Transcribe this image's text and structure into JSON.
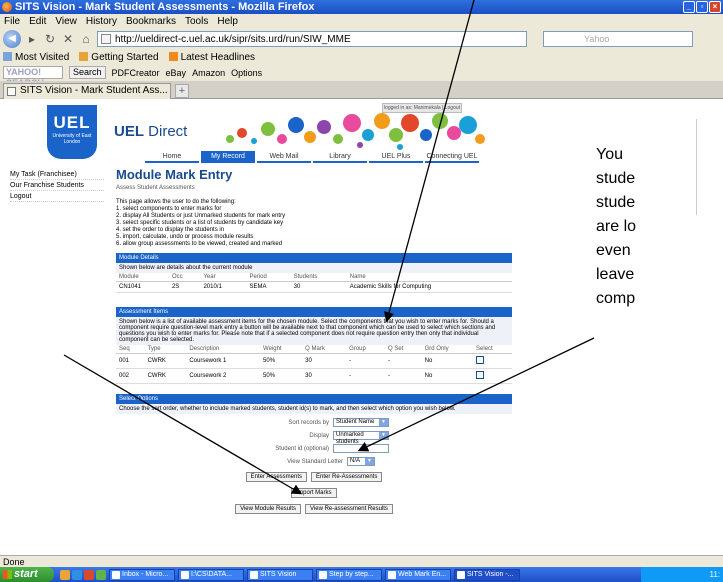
{
  "window": {
    "title": "SITS Vision - Mark Student Assessments - Mozilla Firefox"
  },
  "menu": [
    "File",
    "Edit",
    "View",
    "History",
    "Bookmarks",
    "Tools",
    "Help"
  ],
  "nav": {
    "url": "http://ueldirect-c.uel.ac.uk/sipr/sits.urd/run/SIW_MME",
    "search_placeholder": "Yahoo"
  },
  "bookmarks": [
    "Most Visited",
    "Getting Started",
    "Latest Headlines"
  ],
  "yahoo_toolbar": {
    "brand": "YAHOO! SEARCH",
    "search_label": "Search",
    "items": [
      "PDFCreator",
      "eBay",
      "Amazon",
      "Options"
    ]
  },
  "tabs": [
    {
      "label": "SITS Vision - Mark Student Ass..."
    }
  ],
  "portal": {
    "logo_big": "UEL",
    "logo_small": "University of East London",
    "brand": "UEL",
    "brand_rest": "Direct",
    "login_strip": "logged in as: Manimekala | Logout",
    "nav": [
      "Home",
      "My Record",
      "Web Mail",
      "Library",
      "UEL Plus",
      "Connecting UEL"
    ],
    "active_nav": "My Record"
  },
  "leftnav": [
    "My Task (Franchisee)",
    "Our Franchise Students",
    "Logout"
  ],
  "main": {
    "title": "Module Mark Entry",
    "subtitle": "Assess Student Assessments",
    "intro": [
      "This page allows the user to do the following:",
      "1. select components to enter marks for",
      "2. display All Students or just Unmarked students for mark entry",
      "3. select specific students or a list of students by candidate key",
      "4. set the order to display the students in",
      "5. import, calculate, undo or process module results",
      "6. allow group assessments to be viewed, created and marked"
    ],
    "module_details": {
      "header": "Module Details",
      "note": "Shown below are details about the current module",
      "columns": [
        "Module",
        "Occ",
        "Year",
        "Period",
        "Students",
        "Name"
      ],
      "row": [
        "CN1041",
        "2S",
        "2010/1",
        "SEMA",
        "30",
        "Academic Skills for Computing"
      ]
    },
    "assessment_items": {
      "header": "Assessment Items",
      "note": "Shown below is a list of available assessment items for the chosen module. Select the components that you wish to enter marks for. Should a component require question-level mark entry a button will be available next to that component which can be used to select which sections and questions you wish to enter marks for. Please note that if a selected component does not require question entry then only that individual component can be selected.",
      "columns": [
        "Seq",
        "Type",
        "Description",
        "Weight",
        "Q Mark",
        "Group",
        "Q Set",
        "Grd Only",
        "Select"
      ],
      "rows": [
        [
          "001",
          "CWRK",
          "Coursework 1",
          "50%",
          "30",
          "-",
          "-",
          "No"
        ],
        [
          "002",
          "CWRK",
          "Coursework 2",
          "50%",
          "30",
          "-",
          "-",
          "No"
        ]
      ]
    },
    "select_options": {
      "header": "Select Options",
      "note": "Choose the sort order, whether to include marked students, student id(s) to mark, and then select which option you wish below.",
      "sort_label": "Sort records by",
      "sort_value": "Student Name",
      "display_label": "Display",
      "display_value": "Unmarked students",
      "student_id_label": "Student id (optional)",
      "letter_label": "View Standard Letter",
      "letter_value": "N/A"
    },
    "buttons": {
      "enter": "Enter Assessments",
      "reenter": "Enter Re-Assessments",
      "import": "Import Marks",
      "view_module": "View Module Results",
      "view_reassess": "View Re-assessment Results"
    }
  },
  "callout": [
    "You",
    "stude",
    "stude",
    "are lo",
    "even",
    "leave",
    "comp"
  ],
  "status": "Done",
  "taskbar": {
    "start": "start",
    "tasks": [
      "Inbox - Micro...",
      "I:\\CS\\DATA...",
      "SITS Vision",
      "Step by step...",
      "Web Mark En...",
      "SITS Vision -..."
    ],
    "active_task": "SITS Vision -...",
    "clock": "11:"
  }
}
